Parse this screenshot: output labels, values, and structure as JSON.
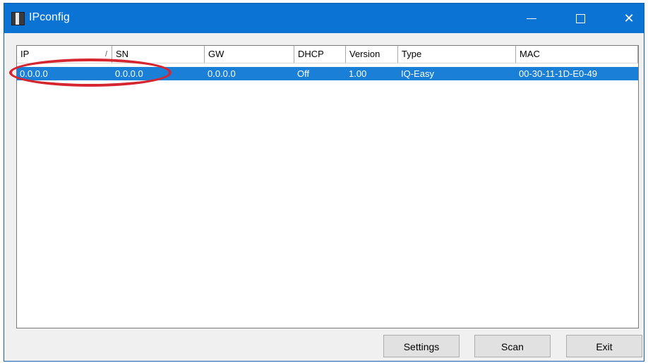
{
  "window": {
    "title": "IPconfig",
    "controls": {
      "minimize": "—",
      "maximize": "☐",
      "close": "✕"
    }
  },
  "list": {
    "columns": [
      {
        "label": "IP",
        "sort_indicator": "/"
      },
      {
        "label": "SN"
      },
      {
        "label": "GW"
      },
      {
        "label": "DHCP"
      },
      {
        "label": "Version"
      },
      {
        "label": "Type"
      },
      {
        "label": "MAC"
      }
    ],
    "rows": [
      {
        "selected": true,
        "ip": "0.0.0.0",
        "sn": "0.0.0.0",
        "gw": "0.0.0.0",
        "dhcp": "Off",
        "version": "1.00",
        "type": "IQ-Easy",
        "mac": "00-30-11-1D-E0-49"
      }
    ]
  },
  "annotation": {
    "color": "#d52630",
    "shape": "ellipse"
  },
  "buttons": {
    "settings": "Settings",
    "scan": "Scan",
    "exit": "Exit"
  },
  "colors": {
    "titlebar": "#0b73d3",
    "selection": "#1a7fd6"
  }
}
